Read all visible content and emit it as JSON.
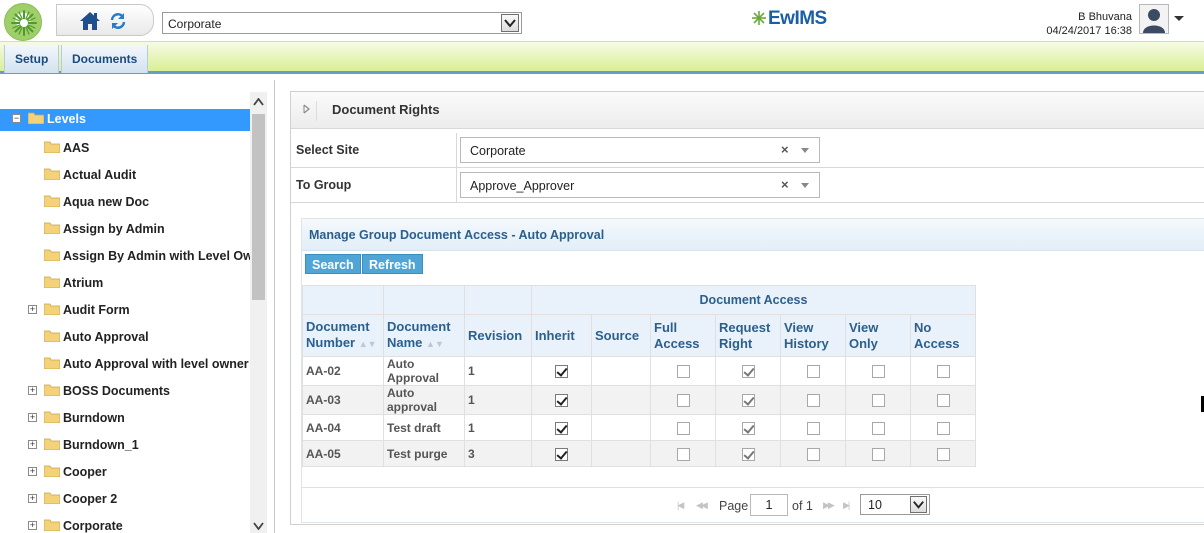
{
  "header": {
    "site_select_value": "Corporate",
    "brand_name": "EwIMS",
    "user_name": "B Bhuvana",
    "datetime": "04/24/2017 16:38"
  },
  "menu": {
    "items": [
      {
        "label": "Setup"
      },
      {
        "label": "Documents"
      }
    ]
  },
  "tree": {
    "items": [
      {
        "label": "Levels",
        "expander": "minus",
        "selected": true
      },
      {
        "label": "AAS",
        "expander": ""
      },
      {
        "label": "Actual Audit",
        "expander": ""
      },
      {
        "label": "Aqua new Doc",
        "expander": ""
      },
      {
        "label": "Assign by Admin",
        "expander": ""
      },
      {
        "label": "Assign By Admin with Level Owr",
        "expander": ""
      },
      {
        "label": "Atrium",
        "expander": ""
      },
      {
        "label": "Audit Form",
        "expander": "plus"
      },
      {
        "label": "Auto Approval",
        "expander": ""
      },
      {
        "label": "Auto Approval with level owner",
        "expander": ""
      },
      {
        "label": "BOSS Documents",
        "expander": "plus"
      },
      {
        "label": "Burndown",
        "expander": "plus"
      },
      {
        "label": "Burndown_1",
        "expander": "plus"
      },
      {
        "label": "Cooper",
        "expander": "plus"
      },
      {
        "label": "Cooper 2",
        "expander": "plus"
      },
      {
        "label": "Corporate",
        "expander": "plus"
      }
    ]
  },
  "panel": {
    "title": "Document Rights",
    "select_site_label": "Select Site",
    "select_site_value": "Corporate",
    "to_group_label": "To Group",
    "to_group_value": "Approve_Approver",
    "clear_glyph": "×"
  },
  "grid": {
    "caption": "Manage Group Document Access - Auto Approval",
    "search_label": "Search",
    "refresh_label": "Refresh",
    "group_header": "Document Access",
    "columns": {
      "doc_number": "Document Number",
      "doc_name": "Document Name",
      "revision": "Revision",
      "inherit": "Inherit",
      "source": "Source",
      "full_access": "Full Access",
      "request_right": "Request Right",
      "view_history": "View History",
      "view_only": "View Only",
      "no_access": "No Access"
    },
    "rows": [
      {
        "number": "AA-02",
        "name": "Auto Approval",
        "revision": "1",
        "inherit": true,
        "source": "",
        "full": false,
        "request": true,
        "history": false,
        "view": false,
        "none": false
      },
      {
        "number": "AA-03",
        "name": "Auto approval",
        "revision": "1",
        "inherit": true,
        "source": "",
        "full": false,
        "request": true,
        "history": false,
        "view": false,
        "none": false
      },
      {
        "number": "AA-04",
        "name": "Test draft",
        "revision": "1",
        "inherit": true,
        "source": "",
        "full": false,
        "request": true,
        "history": false,
        "view": false,
        "none": false
      },
      {
        "number": "AA-05",
        "name": "Test purge",
        "revision": "3",
        "inherit": true,
        "source": "",
        "full": false,
        "request": true,
        "history": false,
        "view": false,
        "none": false
      }
    ]
  },
  "pager": {
    "page_label": "Page",
    "page_value": "1",
    "of_label": "of 1",
    "page_size": "10"
  }
}
